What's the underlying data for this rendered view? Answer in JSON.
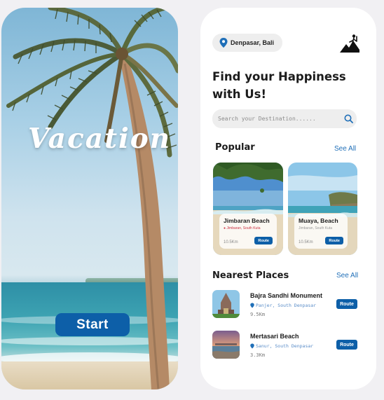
{
  "splash": {
    "title": "Vacation",
    "start_label": "Start"
  },
  "home": {
    "location": "Denpasar, Bali",
    "headline_line1": "Find your Happiness",
    "headline_line2": "with Us!",
    "search_placeholder": "Search your Destination......",
    "popular": {
      "title": "Popular",
      "see_all": "See All",
      "cards": [
        {
          "name": "Jimbaran Beach",
          "sub": "Jimbaran, South Kuta",
          "distance": "10.5Km",
          "route": "Route"
        },
        {
          "name": "Muaya, Beach",
          "sub": "Jimbaran, South Kuta",
          "distance": "10.5Km",
          "route": "Route"
        }
      ]
    },
    "nearest": {
      "title": "Nearest Places",
      "see_all": "See All",
      "items": [
        {
          "name": "Bajra Sandhi Monument",
          "sub": "Panjer, South Denpasar",
          "distance": "9.5Km",
          "route": "Route"
        },
        {
          "name": "Mertasari Beach",
          "sub": "Sanur, South Denpasar",
          "distance": "3.3Km",
          "route": "Route"
        }
      ]
    }
  },
  "colors": {
    "accent": "#0d5fa8",
    "link": "#1f6fb8",
    "pill_bg": "#eeeeee",
    "page_bg": "#f1f0f3"
  },
  "icons": {
    "location": "location-pin-icon",
    "profile": "hiker-icon",
    "search": "search-icon"
  }
}
